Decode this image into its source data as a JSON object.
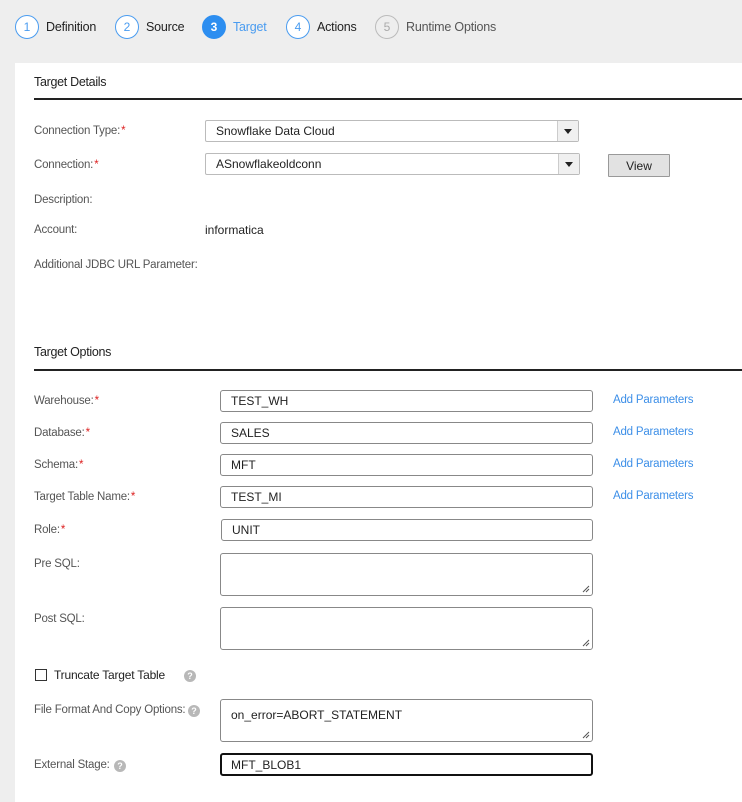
{
  "wizard": {
    "steps": [
      {
        "number": "1",
        "label": "Definition",
        "state": "default"
      },
      {
        "number": "2",
        "label": "Source",
        "state": "default"
      },
      {
        "number": "3",
        "label": "Target",
        "state": "active"
      },
      {
        "number": "4",
        "label": "Actions",
        "state": "default"
      },
      {
        "number": "5",
        "label": "Runtime Options",
        "state": "disabled"
      }
    ]
  },
  "target_details": {
    "title": "Target Details",
    "connection_type": {
      "label": "Connection Type:",
      "required": "*",
      "value": "Snowflake Data Cloud"
    },
    "connection": {
      "label": "Connection:",
      "required": "*",
      "value": "ASnowflakeoldconn"
    },
    "view_button": "View",
    "description": {
      "label": "Description:",
      "value": ""
    },
    "account": {
      "label": "Account:",
      "value": "informatica"
    },
    "jdbc": {
      "label": "Additional JDBC URL Parameter:",
      "value": ""
    }
  },
  "target_options": {
    "title": "Target Options",
    "warehouse": {
      "label": "Warehouse:",
      "required": "*",
      "value": "TEST_WH",
      "link": "Add Parameters"
    },
    "database": {
      "label": "Database:",
      "required": "*",
      "value": "SALES",
      "link": "Add Parameters"
    },
    "schema": {
      "label": "Schema:",
      "required": "*",
      "value": "MFT",
      "link": "Add Parameters"
    },
    "table": {
      "label": "Target Table Name:",
      "required": "*",
      "value": "TEST_MI",
      "link": "Add Parameters"
    },
    "role": {
      "label": "Role:",
      "required": "*",
      "value": "UNIT"
    },
    "pre_sql": {
      "label": "Pre SQL:",
      "value": ""
    },
    "post_sql": {
      "label": "Post SQL:",
      "value": ""
    },
    "truncate": {
      "label": "Truncate Target Table",
      "checked": false
    },
    "file_format": {
      "label": "File Format And Copy Options:",
      "value": "on_error=ABORT_STATEMENT"
    },
    "external_stage": {
      "label": "External Stage:",
      "value": "MFT_BLOB1"
    },
    "help_glyph": "?"
  }
}
